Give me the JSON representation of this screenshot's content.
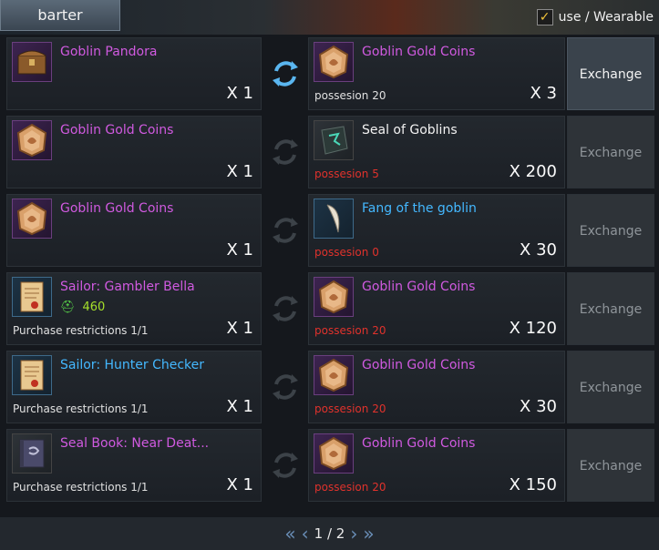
{
  "tab": {
    "label": "barter"
  },
  "filter": {
    "checked": true,
    "label": "use / Wearable"
  },
  "exchange_label": "Exchange",
  "rows": [
    {
      "left": {
        "name": "Goblin Pandora",
        "color": "purple",
        "qty": "X 1",
        "icon": "chest-icon"
      },
      "right": {
        "name": "Goblin Gold Coins",
        "color": "purple",
        "sub": "possesion 20",
        "sub_color": "gray",
        "qty": "X 3",
        "icon": "gold-coin-icon"
      },
      "active": true
    },
    {
      "left": {
        "name": "Goblin Gold Coins",
        "color": "purple",
        "qty": "X 1",
        "icon": "gold-coin-icon"
      },
      "right": {
        "name": "Seal of Goblins",
        "color": "white",
        "sub": "possesion 5",
        "sub_color": "red",
        "qty": "X 200",
        "icon": "seal-icon"
      },
      "active": false
    },
    {
      "left": {
        "name": "Goblin Gold Coins",
        "color": "purple",
        "qty": "X 1",
        "icon": "gold-coin-icon"
      },
      "right": {
        "name": "Fang of the goblin",
        "color": "blue",
        "sub": "possesion 0",
        "sub_color": "red",
        "qty": "X 30",
        "icon": "fang-icon"
      },
      "active": false
    },
    {
      "left": {
        "name": "Sailor: Gambler Bella",
        "color": "purple",
        "qty": "X 1",
        "icon": "scroll-icon",
        "sub": "Purchase restrictions 1/1",
        "badge": "460"
      },
      "right": {
        "name": "Goblin Gold Coins",
        "color": "purple",
        "sub": "possesion 20",
        "sub_color": "red",
        "qty": "X 120",
        "icon": "gold-coin-icon"
      },
      "active": false
    },
    {
      "left": {
        "name": "Sailor: Hunter Checker",
        "color": "blue",
        "qty": "X 1",
        "icon": "scroll-icon",
        "sub": "Purchase restrictions 1/1"
      },
      "right": {
        "name": "Goblin Gold Coins",
        "color": "purple",
        "sub": "possesion 20",
        "sub_color": "red",
        "qty": "X 30",
        "icon": "gold-coin-icon"
      },
      "active": false
    },
    {
      "left": {
        "name": "Seal Book: Near Deat...",
        "color": "purple",
        "qty": "X 1",
        "icon": "book-icon",
        "sub": "Purchase restrictions 1/1"
      },
      "right": {
        "name": "Goblin Gold Coins",
        "color": "purple",
        "sub": "possesion 20",
        "sub_color": "red",
        "qty": "X 150",
        "icon": "gold-coin-icon"
      },
      "active": false
    }
  ],
  "pager": {
    "first": "«",
    "prev": "‹",
    "page": "1 / 2",
    "next": "›",
    "last": "»"
  }
}
